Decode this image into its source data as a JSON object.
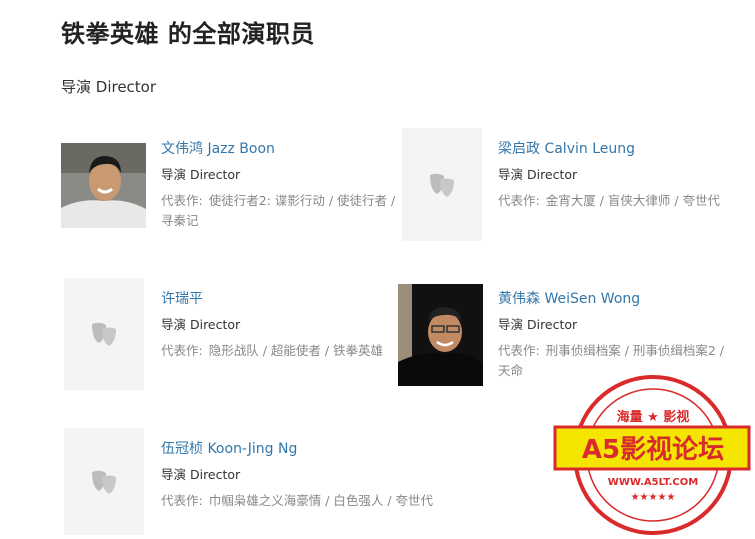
{
  "page": {
    "title": "铁拳英雄 的全部演职员",
    "section": "导演 Director"
  },
  "cast": [
    {
      "name": "文伟鸿 Jazz Boon",
      "role": "导演 Director",
      "works_label": "代表作:",
      "works": "使徒行者2: 谍影行动 / 使徒行者 / 寻秦记",
      "photo": "portrait"
    },
    {
      "name": "梁启政 Calvin Leung",
      "role": "导演 Director",
      "works_label": "代表作:",
      "works": "金宵大厦 / 盲侠大律师 / 夸世代",
      "photo": "placeholder"
    },
    {
      "name": "许瑞平",
      "role": "导演 Director",
      "works_label": "代表作:",
      "works": "隐形战队 / 超能使者 / 铁拳英雄",
      "photo": "placeholder"
    },
    {
      "name": "黄伟森 WeiSen Wong",
      "role": "导演 Director",
      "works_label": "代表作:",
      "works": "刑事侦缉档案 / 刑事侦缉档案2 / 天命",
      "photo": "portrait"
    },
    {
      "name": "伍冠桢 Koon-Jing Ng",
      "role": "导演 Director",
      "works_label": "代表作:",
      "works": "巾帼枭雄之义海豪情 / 白色强人 / 夸世代",
      "photo": "placeholder"
    }
  ],
  "watermark": {
    "top": "海量 ★ 影视",
    "main": "A5影视论坛",
    "url": "WWW.A5LT.COM"
  },
  "colors": {
    "link": "#3377aa",
    "stamp_red": "#d92b2b",
    "stamp_yellow": "#f5e600"
  }
}
